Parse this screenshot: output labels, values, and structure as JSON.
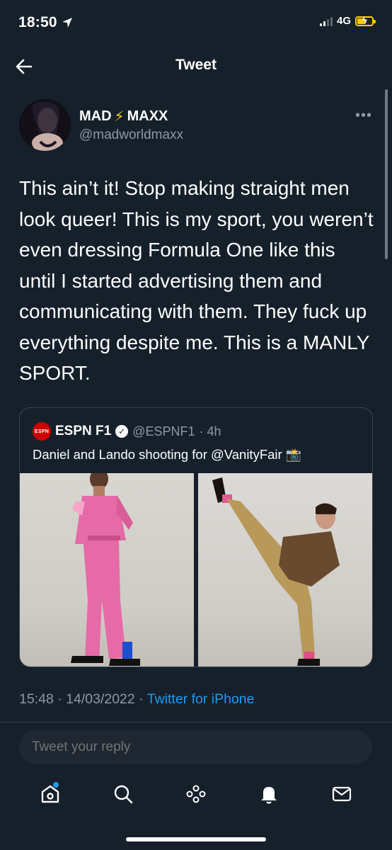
{
  "status_bar": {
    "time": "18:50",
    "network": "4G"
  },
  "header": {
    "title": "Tweet"
  },
  "author": {
    "name_part1": "MAD",
    "name_emoji": "⚡",
    "name_part2": "MAXX",
    "handle": "@madworldmaxx"
  },
  "tweet": {
    "text": "This ain’t it! Stop making straight men look queer! This is my sport, you weren’t even dressing Formula One like this until I started advertising them and communicating with them. They fuck up everything despite me. This is a MANLY SPORT.",
    "time": "15:48",
    "date": "14/03/2022",
    "separator": "·",
    "app": "Twitter for iPhone"
  },
  "quoted": {
    "logo_text": "ESPN",
    "name": "ESPN F1",
    "handle": "@ESPNF1",
    "age": "· 4h",
    "text": "Daniel and Lando shooting for @VanityFair",
    "emoji": "📸"
  },
  "reply": {
    "placeholder": "Tweet your reply"
  },
  "tabbar": {
    "items": [
      "home",
      "search",
      "spaces",
      "notifications",
      "messages"
    ]
  },
  "colors": {
    "background": "#15202b",
    "accent": "#1d9bf0",
    "muted": "#8b98a5",
    "border": "#38444d"
  }
}
